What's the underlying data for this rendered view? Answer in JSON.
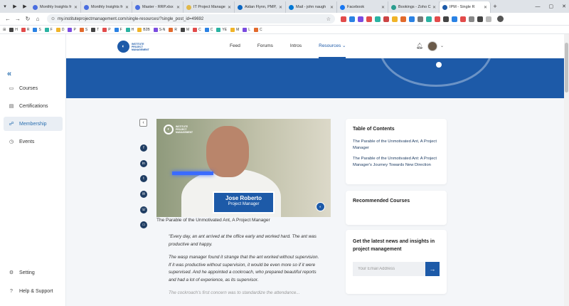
{
  "browser": {
    "tabs": [
      {
        "label": "Monthly Insights fr",
        "color": "#4a6ee0"
      },
      {
        "label": "Monthly Insights fr",
        "color": "#4a6ee0"
      },
      {
        "label": "Master - RRP.xlsx",
        "color": "#4a6ee0"
      },
      {
        "label": "IT Project Manage",
        "color": "#e0b84a"
      },
      {
        "label": "Aidan Flynn, PMP,",
        "color": "#0a66c2"
      },
      {
        "label": "Mail - john naugh",
        "color": "#0078d4"
      },
      {
        "label": "Facebook",
        "color": "#1877f2"
      },
      {
        "label": "Bookings - Zoho C",
        "color": "#2a9d8f"
      },
      {
        "label": "IPM - Single R",
        "color": "#1d5aa8"
      }
    ],
    "url": "my.instituteprojectmanagement.com/single-resources/?single_post_id=49692",
    "bookmarks": [
      "H",
      "R",
      "S",
      "F",
      "D",
      "P",
      "S",
      "T",
      "P",
      "F",
      "H",
      "B2B",
      "S-N",
      "R",
      "M",
      "C",
      "C",
      "YE",
      "M",
      "L",
      "C"
    ]
  },
  "sidebar": {
    "items": [
      {
        "label": "Courses",
        "icon": "courses-icon",
        "glyph": "▭"
      },
      {
        "label": "Certifications",
        "icon": "certifications-icon",
        "glyph": "▤"
      },
      {
        "label": "Membership",
        "icon": "membership-icon",
        "glyph": "☍"
      },
      {
        "label": "Events",
        "icon": "events-icon",
        "glyph": "◷"
      }
    ],
    "bottom": [
      {
        "label": "Setting",
        "icon": "gear-icon",
        "glyph": "⚙"
      },
      {
        "label": "Help & Support",
        "icon": "help-icon",
        "glyph": "?"
      }
    ]
  },
  "header": {
    "logo_text": [
      "INSTITUTE",
      "PROJECT",
      "MANAGEMENT"
    ],
    "nav": [
      "Feed",
      "Forums",
      "Intros",
      "Resources"
    ],
    "active_nav": "Resources"
  },
  "video": {
    "logo_text": [
      "INSTITUTE",
      "PROJECT",
      "MANAGEMENT"
    ],
    "name": "Jose Roberto",
    "role": "Project Manager",
    "caption": "The Parable of the Unmotivated Ant, A Project Manager"
  },
  "article": {
    "paragraphs": [
      "\"Every day, an ant arrived at the office early and worked hard. The ant was productive and happy.",
      "The wasp manager found it strange that the ant worked without supervision. If it was productive without supervision, it would be even more so if it were supervised. And he appointed a cockroach, who prepared beautiful reports and had a lot of experience, as its supervisor.",
      "The cockroach's first concern was to standardize the attendance..."
    ]
  },
  "toc": {
    "title": "Table of Contents",
    "links": [
      "The Parable of the Unmotivated Ant, A Project Manager",
      "The Parable of the Unmotivated Ant: A Project Manager's Journey Towards New Direction"
    ]
  },
  "recommended": {
    "title": "Recommended Courses"
  },
  "newsletter": {
    "title": "Get the latest news and insights in project management",
    "placeholder": "Your Email Address"
  },
  "colors": {
    "brand": "#1d5aa8",
    "dark": "#1f3d63"
  }
}
